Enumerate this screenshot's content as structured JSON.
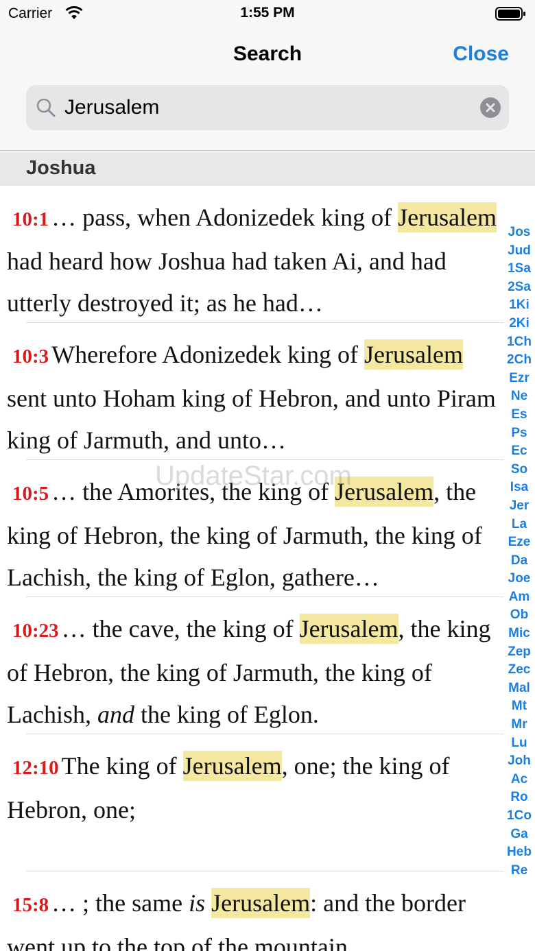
{
  "status_bar": {
    "carrier": "Carrier",
    "time": "1:55 PM"
  },
  "nav": {
    "title": "Search",
    "close_label": "Close"
  },
  "search": {
    "value": "Jerusalem",
    "placeholder": ""
  },
  "section": {
    "title": "Joshua"
  },
  "results": [
    {
      "ref": "10:1",
      "parts": [
        {
          "t": "… pass, when Adonizedek king of "
        },
        {
          "t": "Jerusalem",
          "hl": true
        },
        {
          "t": " had heard how Joshua had taken Ai, and had utterly destroyed it; as he had…"
        }
      ],
      "lines": 3
    },
    {
      "ref": "10:3",
      "parts": [
        {
          "t": "Wherefore Adonizedek king of "
        },
        {
          "t": "Jerusalem",
          "hl": true
        },
        {
          "t": " sent unto Hoham king of Hebron, and unto Piram king of Jarmuth, and unto…"
        }
      ],
      "lines": 3
    },
    {
      "ref": "10:5",
      "parts": [
        {
          "t": "… the Amorites, the king of "
        },
        {
          "t": "Jerusalem",
          "hl": true
        },
        {
          "t": ", the king of Hebron, the king of Jarmuth, the king of Lachish, the king of Eglon, gathere…"
        }
      ],
      "lines": 3
    },
    {
      "ref": "10:23",
      "parts": [
        {
          "t": "… the cave, the king of "
        },
        {
          "t": "Jerusalem",
          "hl": true
        },
        {
          "t": ", the king of Hebron, the king of Jarmuth, the king of Lachish, "
        },
        {
          "t": "and",
          "it": true
        },
        {
          "t": " the king of Eglon."
        }
      ],
      "lines": 3
    },
    {
      "ref": "12:10",
      "parts": [
        {
          "t": "The king of "
        },
        {
          "t": "Jerusalem",
          "hl": true
        },
        {
          "t": ", one; the king of Hebron, one;"
        }
      ],
      "lines": 3
    },
    {
      "ref": "15:8",
      "parts": [
        {
          "t": "… ; the same "
        },
        {
          "t": "is",
          "it": true
        },
        {
          "t": " "
        },
        {
          "t": "Jerusalem",
          "hl": true
        },
        {
          "t": ": and the border went up to the top of the mountain"
        }
      ],
      "lines": 2
    }
  ],
  "index": [
    "Jos",
    "Jud",
    "1Sa",
    "2Sa",
    "1Ki",
    "2Ki",
    "1Ch",
    "2Ch",
    "Ezr",
    "Ne",
    "Es",
    "Ps",
    "Ec",
    "So",
    "Isa",
    "Jer",
    "La",
    "Eze",
    "Da",
    "Joe",
    "Am",
    "Ob",
    "Mic",
    "Zep",
    "Zec",
    "Mal",
    "Mt",
    "Mr",
    "Lu",
    "Joh",
    "Ac",
    "Ro",
    "1Co",
    "Ga",
    "Heb",
    "Re"
  ],
  "watermark": "UpdateStar.com",
  "colors": {
    "accent": "#1a7fe0",
    "ref": "#d81c1c",
    "highlight": "#f4e7a0"
  }
}
